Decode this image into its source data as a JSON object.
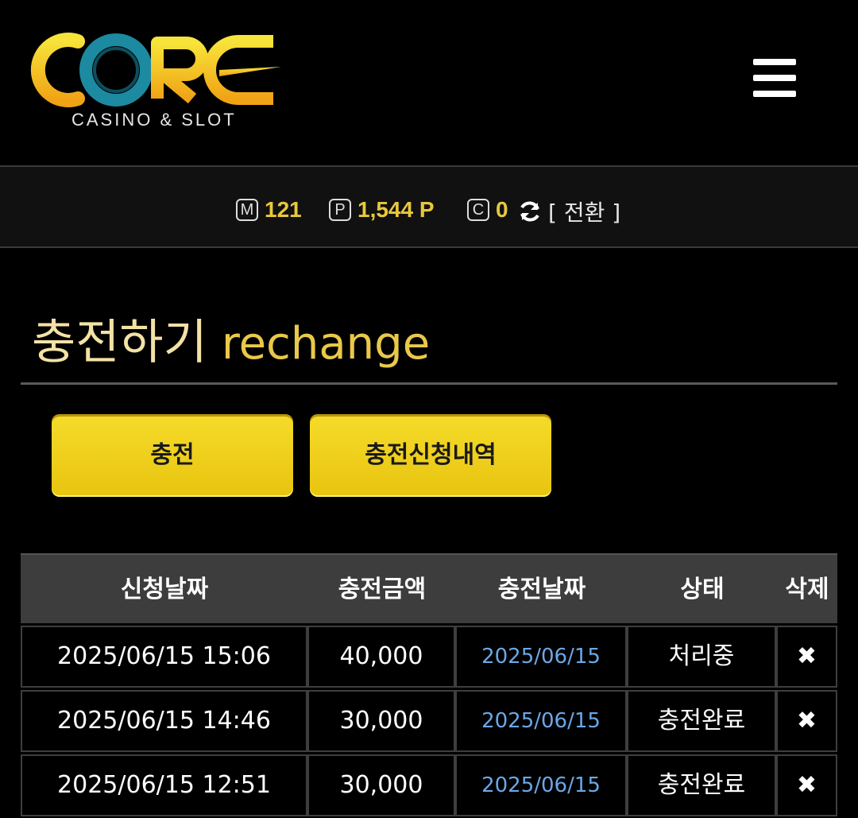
{
  "header": {
    "logo_text": "CORE",
    "logo_subtitle": "CASINO & SLOT",
    "menu_icon": "hamburger-menu-icon"
  },
  "balance": {
    "money_icon_letter": "M",
    "money_value": "121",
    "point_icon_letter": "P",
    "point_value": "1,544 P",
    "coin_icon_letter": "C",
    "coin_value": "0",
    "switch_label": "[ 전환 ]",
    "switch_icon": "refresh-icon"
  },
  "page": {
    "title_ko": "충전하기",
    "title_en": "rechange"
  },
  "tabs": {
    "recharge_label": "충전",
    "history_label": "충전신청내역"
  },
  "table": {
    "columns": [
      "신청날짜",
      "충전금액",
      "충전날짜",
      "상태",
      "삭제"
    ],
    "rows": [
      {
        "request_date": "2025/06/15 15:06",
        "amount": "40,000",
        "charge_date": "2025/06/15",
        "status": "처리중",
        "delete": "✖"
      },
      {
        "request_date": "2025/06/15 14:46",
        "amount": "30,000",
        "charge_date": "2025/06/15",
        "status": "충전완료",
        "delete": "✖"
      },
      {
        "request_date": "2025/06/15 12:51",
        "amount": "30,000",
        "charge_date": "2025/06/15",
        "status": "충전완료",
        "delete": "✖"
      }
    ]
  },
  "colors": {
    "accent_yellow": "#f0cf1c",
    "title_gold": "#e9c84a",
    "link_blue": "#6aa8e8",
    "logo_teal": "#1c8aa0"
  }
}
